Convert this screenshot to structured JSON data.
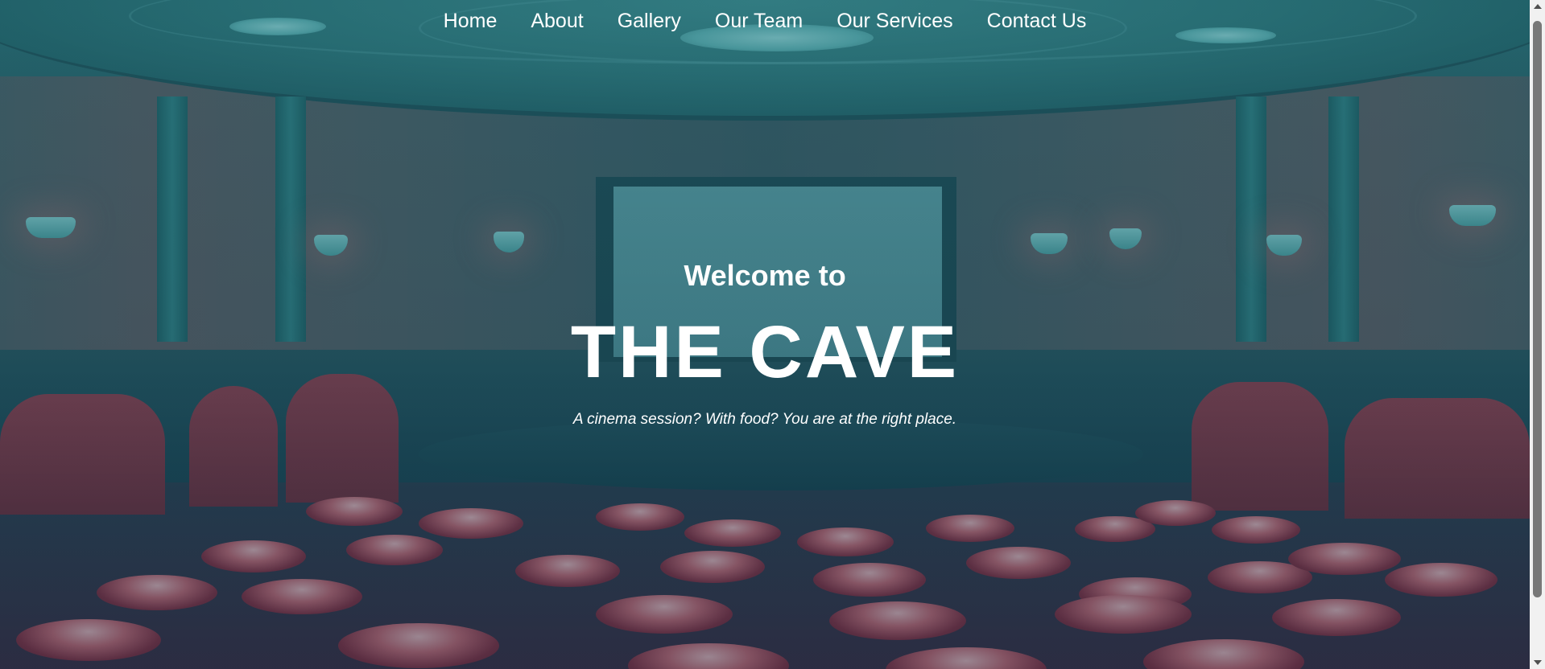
{
  "nav": {
    "items": [
      {
        "label": "Home"
      },
      {
        "label": "About"
      },
      {
        "label": "Gallery"
      },
      {
        "label": "Our Team"
      },
      {
        "label": "Our Services"
      },
      {
        "label": "Contact Us"
      }
    ]
  },
  "hero": {
    "welcome": "Welcome to",
    "title": "THE CAVE",
    "tagline": "A cinema session? With food? You are at the right place."
  },
  "colors": {
    "text": "#ffffff",
    "overlay": "#145a64",
    "scrollbar_track": "#f1f1f1",
    "scrollbar_thumb": "#787878"
  }
}
